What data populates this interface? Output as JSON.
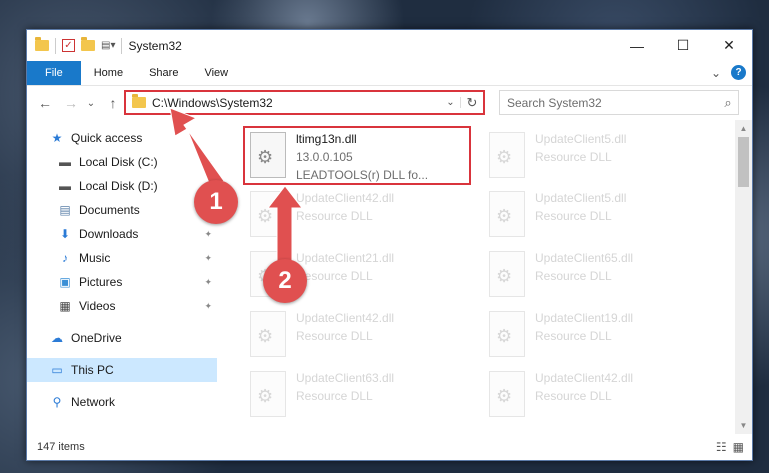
{
  "window": {
    "title": "System32"
  },
  "controls": {
    "minimize": "—",
    "maximize": "☐",
    "close": "✕"
  },
  "ribbon": {
    "tabs": [
      {
        "label": "File"
      },
      {
        "label": "Home"
      },
      {
        "label": "Share"
      },
      {
        "label": "View"
      }
    ],
    "expand_icon": "⌄",
    "help": "?"
  },
  "nav": {
    "back": "←",
    "forward": "→",
    "recent": "⌄",
    "up": "↑"
  },
  "address": {
    "path": "C:\\Windows\\System32",
    "dropdown": "⌄",
    "refresh": "↻"
  },
  "search": {
    "placeholder": "Search System32",
    "icon": "⌕"
  },
  "sidebar": {
    "items": [
      {
        "label": "Quick access",
        "icon": "★",
        "pinned": false
      },
      {
        "label": "Local Disk (C:)",
        "icon": "▬",
        "pinned": true
      },
      {
        "label": "Local Disk (D:)",
        "icon": "▬",
        "pinned": false
      },
      {
        "label": "Documents",
        "icon": "▤",
        "pinned": true
      },
      {
        "label": "Downloads",
        "icon": "⬇",
        "pinned": true
      },
      {
        "label": "Music",
        "icon": "♪",
        "pinned": true
      },
      {
        "label": "Pictures",
        "icon": "▣",
        "pinned": true
      },
      {
        "label": "Videos",
        "icon": "▦",
        "pinned": true
      },
      {
        "label": "OneDrive",
        "icon": "☁",
        "pinned": false
      },
      {
        "label": "This PC",
        "icon": "▭",
        "pinned": false
      },
      {
        "label": "Network",
        "icon": "⚲",
        "pinned": false
      }
    ],
    "pin_glyph": "📌"
  },
  "files": [
    {
      "name": "ltimg13n.dll",
      "version": "13.0.0.105",
      "desc": "LEADTOOLS(r) DLL fo..."
    },
    {
      "name": "UpdateClient5.dll",
      "desc": "Resource DLL"
    },
    {
      "name": "UpdateClient42.dll",
      "desc": "Resource DLL"
    },
    {
      "name": "UpdateClient5.dll",
      "desc": "Resource DLL"
    },
    {
      "name": "UpdateClient21.dll",
      "desc": "Resource DLL"
    },
    {
      "name": "UpdateClient65.dll",
      "desc": "Resource DLL"
    },
    {
      "name": "UpdateClient42.dll",
      "desc": "Resource DLL"
    },
    {
      "name": "UpdateClient19.dll",
      "desc": "Resource DLL"
    },
    {
      "name": "UpdateClient63.dll",
      "desc": "Resource DLL"
    },
    {
      "name": "UpdateClient42.dll",
      "desc": "Resource DLL"
    }
  ],
  "status": {
    "item_count": "147 items"
  },
  "annotations": {
    "step1": "1",
    "step2": "2",
    "color": "#e05050"
  }
}
